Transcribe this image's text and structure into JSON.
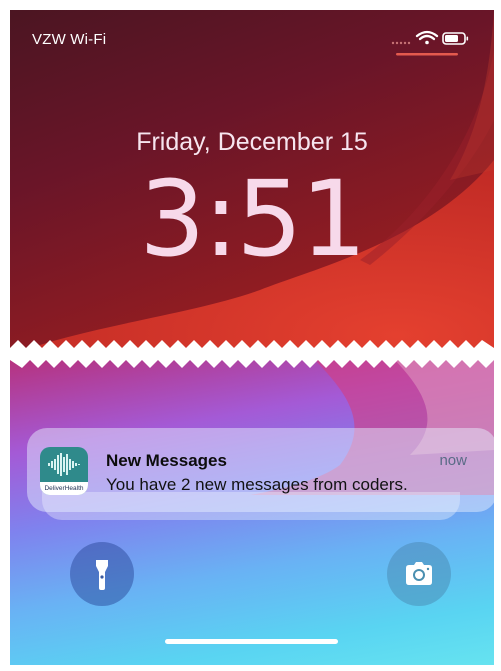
{
  "status_bar": {
    "carrier": "VZW Wi-Fi",
    "icons": [
      "signal-dots-icon",
      "wifi-icon",
      "battery-icon"
    ]
  },
  "lock_screen": {
    "date": "Friday, December 15",
    "time": "3:51"
  },
  "notification": {
    "app_icon_name": "deliverhealth-app-icon",
    "app_icon_text": "DeliverHealth",
    "title": "New Messages",
    "timestamp": "now",
    "body": "You have 2 new messages from coders."
  },
  "quick_actions": {
    "flashlight_icon": "flashlight-icon",
    "camera_icon": "camera-icon"
  },
  "colors": {
    "top_wallpaper": "#6a1528",
    "red_wave": "#e03a2c",
    "bottom_gradient_start": "#b7307a",
    "bottom_gradient_end": "#66e3f0"
  }
}
